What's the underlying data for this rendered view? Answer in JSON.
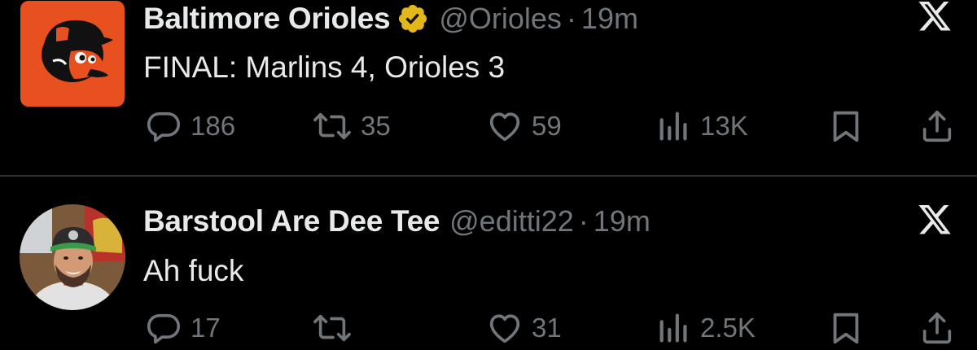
{
  "tweets": [
    {
      "display_name": "Baltimore Orioles",
      "verified": true,
      "handle": "@Orioles",
      "separator": "·",
      "time": "19m",
      "text": "FINAL: Marlins 4, Orioles 3",
      "avatar": "orioles-bird-logo",
      "source_icon": "x-logo-icon",
      "stats": {
        "replies": "186",
        "retweets": "35",
        "likes": "59",
        "views": "13K"
      }
    },
    {
      "display_name": "Barstool Are Dee Tee",
      "verified": false,
      "handle": "@editti22",
      "separator": "·",
      "time": "19m",
      "text": "Ah fuck",
      "avatar": "user-photo",
      "source_icon": "x-logo-icon",
      "stats": {
        "replies": "17",
        "retweets": "",
        "likes": "31",
        "views": "2.5K"
      }
    }
  ],
  "colors": {
    "background": "#000000",
    "text_primary": "#e7e9ea",
    "text_secondary": "#71767b",
    "divider": "#2f3336",
    "verified_gold": "#e2b719",
    "orioles_orange": "#e8501f"
  },
  "icons": [
    "reply-icon",
    "retweet-icon",
    "like-icon",
    "views-icon",
    "bookmark-icon",
    "share-icon"
  ]
}
